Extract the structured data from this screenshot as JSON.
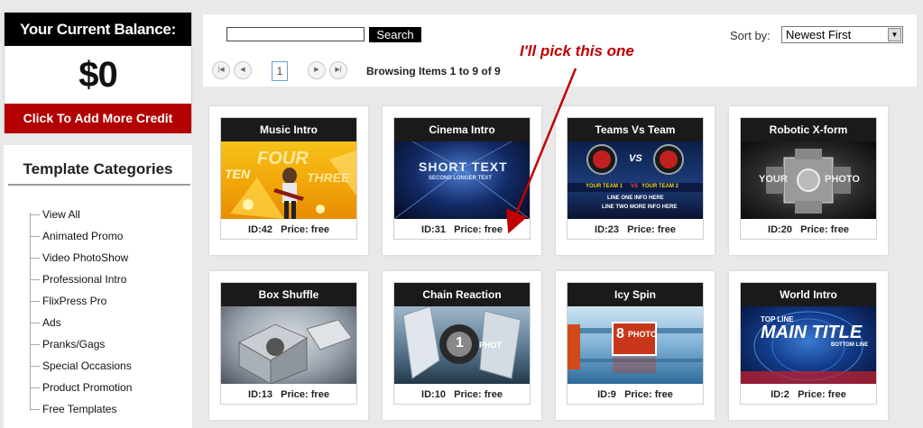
{
  "balance": {
    "header": "Your Current Balance:",
    "amount": "$0",
    "add_credit": "Click To Add More Credit"
  },
  "categories": {
    "title": "Template Categories",
    "items": [
      "View All",
      "Animated Promo",
      "Video PhotoShow",
      "Professional Intro",
      "FlixPress Pro",
      "Ads",
      "Pranks/Gags",
      "Special Occasions",
      "Product Promotion",
      "Free Templates"
    ]
  },
  "search": {
    "value": "",
    "button_label": "Search"
  },
  "sort": {
    "label": "Sort by:",
    "selected": "Newest First"
  },
  "pagination": {
    "current_page": "1",
    "browsing_text": "Browsing Items 1 to 9 of 9"
  },
  "annotation": "I'll pick this one",
  "templates": [
    {
      "title": "Music Intro",
      "id": "ID:42",
      "price": "Price: free"
    },
    {
      "title": "Cinema Intro",
      "id": "ID:31",
      "price": "Price: free"
    },
    {
      "title": "Teams Vs Team",
      "id": "ID:23",
      "price": "Price: free"
    },
    {
      "title": "Robotic X-form",
      "id": "ID:20",
      "price": "Price: free"
    },
    {
      "title": "Box Shuffle",
      "id": "ID:13",
      "price": "Price: free"
    },
    {
      "title": "Chain Reaction",
      "id": "ID:10",
      "price": "Price: free"
    },
    {
      "title": "Icy Spin",
      "id": "ID:9",
      "price": "Price: free"
    },
    {
      "title": "World Intro",
      "id": "ID:2",
      "price": "Price: free"
    }
  ],
  "thumb_text": {
    "music": [
      "TEN",
      "FOUR",
      "THREE"
    ],
    "cinema": [
      "SHORT TEXT",
      "SECOND LONGER TEXT"
    ],
    "teams": [
      "VS",
      "YOUR TEAM 1",
      "VS",
      "YOUR TEAM 2",
      "LINE ONE INFO HERE",
      "LINE TWO MORE INFO HERE"
    ],
    "robotic": [
      "YOUR",
      "PHOTO"
    ],
    "chain": [
      "1",
      "PHOT"
    ],
    "icy": [
      "8",
      "PHOTO"
    ],
    "world": [
      "TOP LINE",
      "MAIN TITLE",
      "BOTTOM LINE"
    ]
  },
  "colors": {
    "accent_red": "#b30000",
    "annotation_red": "#c00000",
    "header_black": "#000000"
  }
}
